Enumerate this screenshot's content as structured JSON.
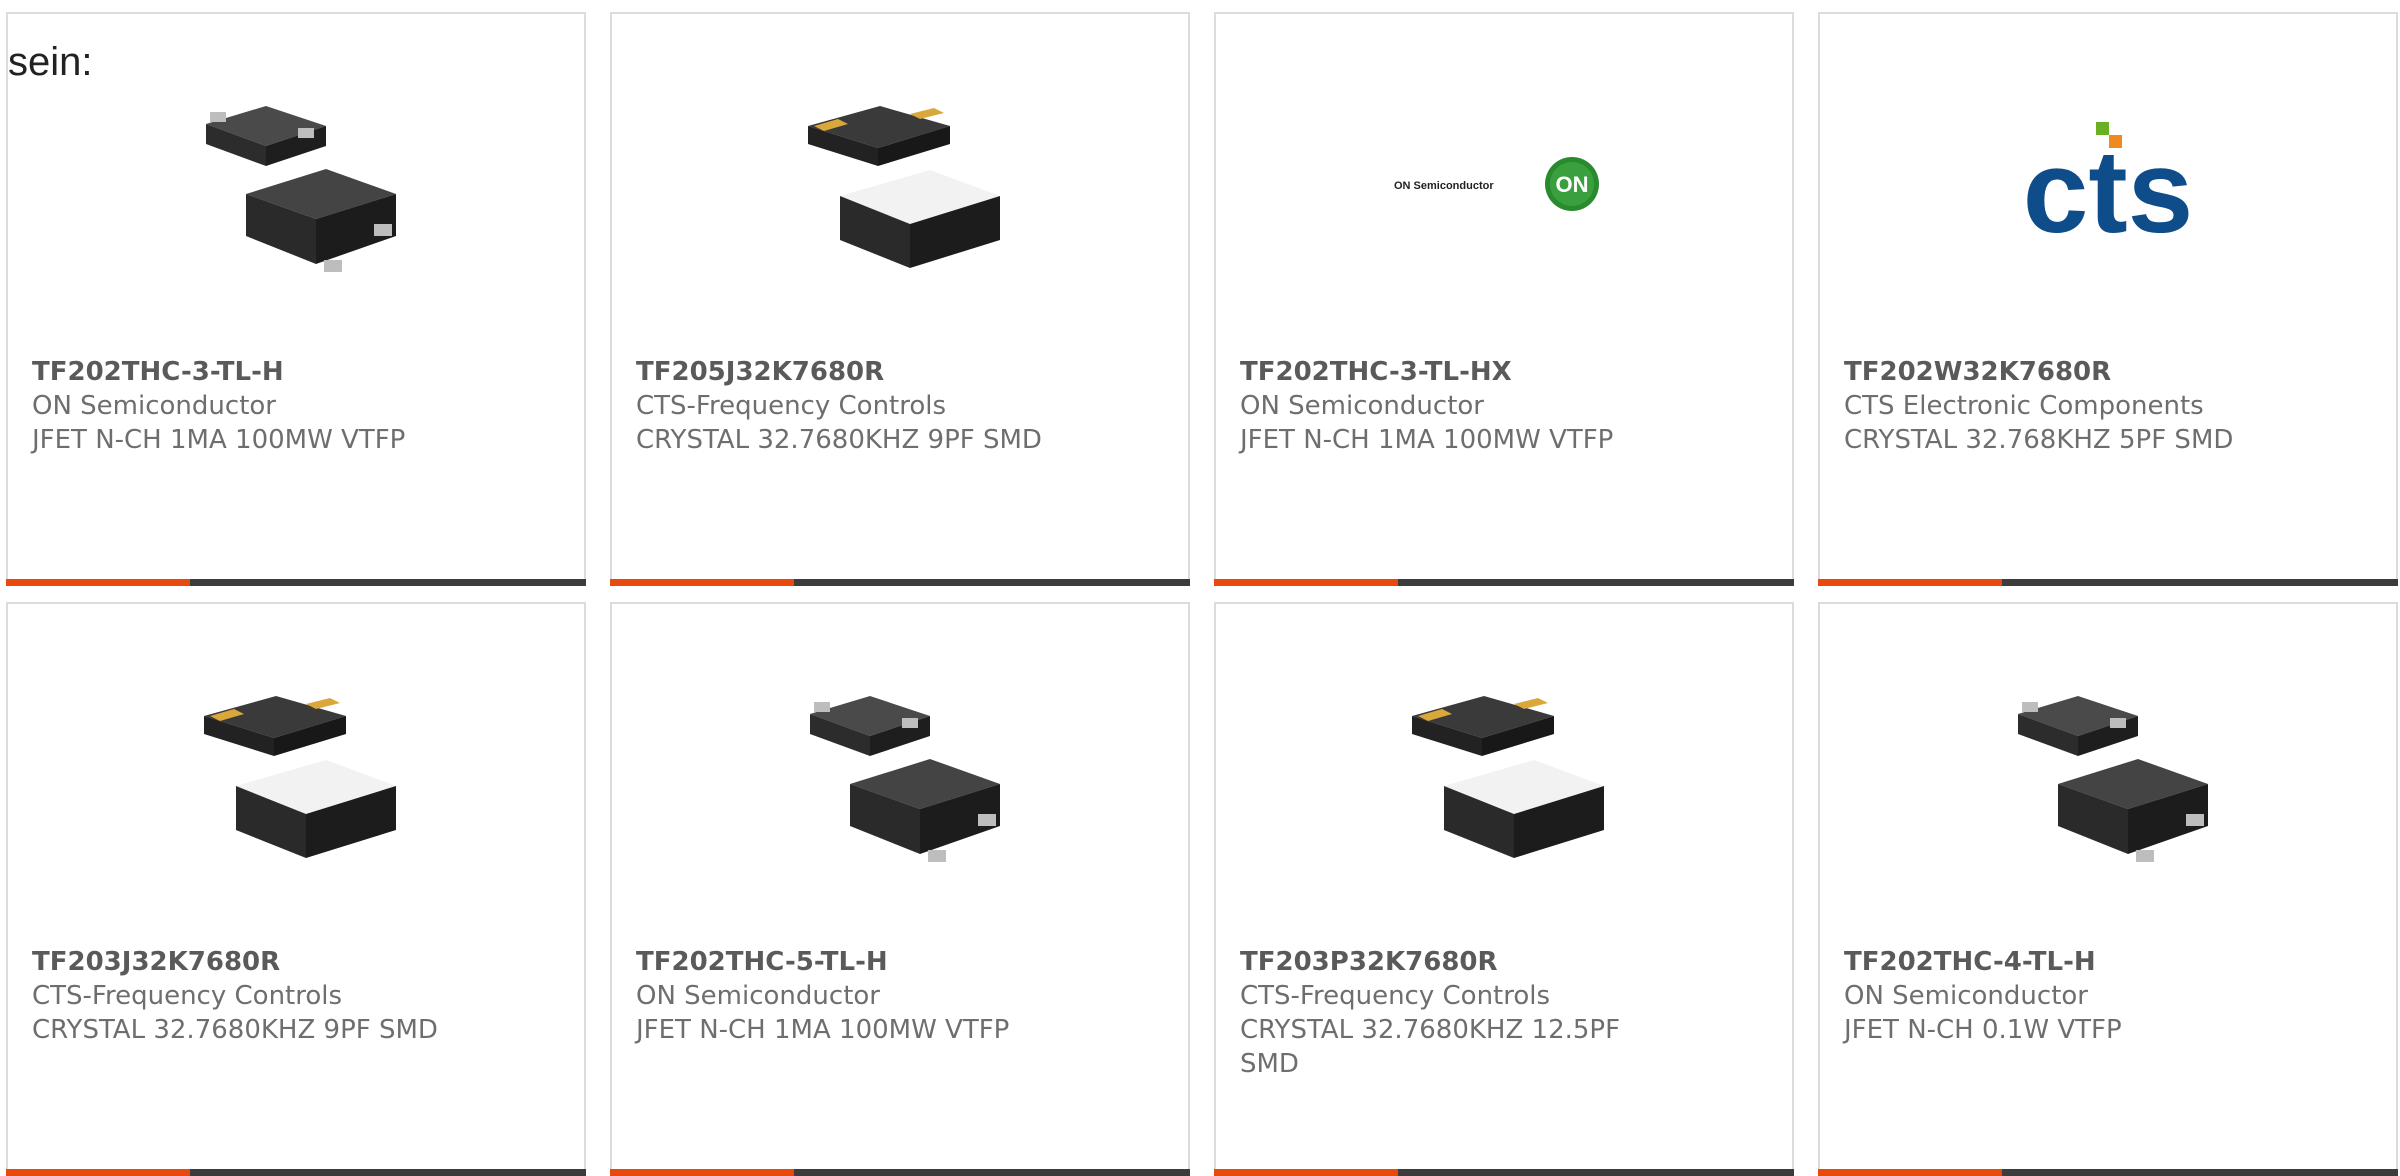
{
  "intro_text": "sein:",
  "products": [
    {
      "part_number": "TF202THC-3-TL-H",
      "manufacturer": "ON Semiconductor",
      "description": "JFET N-CH 1MA 100MW VTFP",
      "image": "sot-package-icon"
    },
    {
      "part_number": "TF205J32K7680R",
      "manufacturer": "CTS-Frequency Controls",
      "description": "CRYSTAL 32.7680KHZ 9PF SMD",
      "image": "crystal-package-icon"
    },
    {
      "part_number": "TF202THC-3-TL-HX",
      "manufacturer": "ON Semiconductor",
      "description": "JFET N-CH 1MA 100MW VTFP",
      "image": "on-semiconductor-logo",
      "logo_text": "ON Semiconductor",
      "logo_mark": "ON"
    },
    {
      "part_number": "TF202W32K7680R",
      "manufacturer": "CTS Electronic Components",
      "description": "CRYSTAL 32.768KHZ 5PF SMD",
      "image": "cts-logo",
      "logo_text": "cts"
    },
    {
      "part_number": "TF203J32K7680R",
      "manufacturer": "CTS-Frequency Controls",
      "description": "CRYSTAL 32.7680KHZ 9PF SMD",
      "image": "crystal-package-icon"
    },
    {
      "part_number": "TF202THC-5-TL-H",
      "manufacturer": "ON Semiconductor",
      "description": "JFET N-CH 1MA 100MW VTFP",
      "image": "sot-package-icon"
    },
    {
      "part_number": "TF203P32K7680R",
      "manufacturer": "CTS-Frequency Controls",
      "description": "CRYSTAL 32.7680KHZ 12.5PF SMD",
      "image": "crystal-package-icon"
    },
    {
      "part_number": "TF202THC-4-TL-H",
      "manufacturer": "ON Semiconductor",
      "description": "JFET N-CH 0.1W VTFP",
      "image": "sot-package-icon"
    }
  ],
  "colors": {
    "accent": "#e84a0c",
    "bar": "#3c3c3c",
    "on_logo_green": "#2a8a2e",
    "cts_blue": "#0e4c8a",
    "cts_green": "#6ab023",
    "cts_orange": "#f08a1c"
  }
}
